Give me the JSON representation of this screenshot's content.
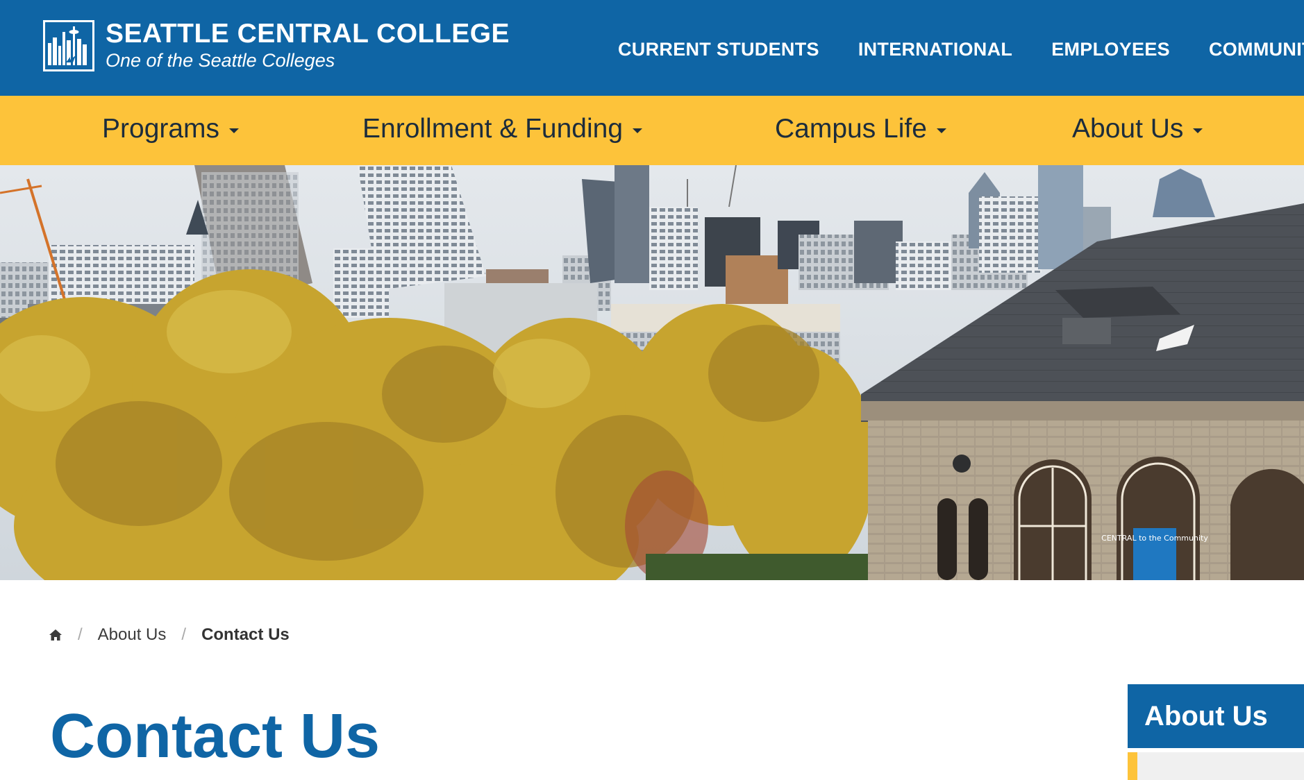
{
  "header": {
    "college_name": "SEATTLE CENTRAL COLLEGE",
    "tagline": "One of the Seattle Colleges",
    "logo_icon": "skyline-logo-icon",
    "audience_links": [
      "CURRENT STUDENTS",
      "INTERNATIONAL",
      "EMPLOYEES",
      "COMMUNITY"
    ]
  },
  "main_nav": {
    "items": [
      "Programs",
      "Enrollment & Funding",
      "Campus Life",
      "About Us"
    ]
  },
  "hero": {
    "image": "seattle-skyline-campus-photo",
    "banner_text": "CENTRAL to the Community"
  },
  "breadcrumb": {
    "home_icon": "home-icon",
    "items": [
      "About Us",
      "Contact Us"
    ]
  },
  "page": {
    "title": "Contact Us"
  },
  "sidebar": {
    "heading": "About Us"
  },
  "colors": {
    "brand_blue": "#0f65a5",
    "brand_gold": "#fdc33a"
  }
}
